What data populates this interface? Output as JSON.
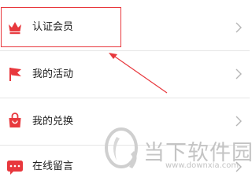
{
  "menu": {
    "items": [
      {
        "label": "认证会员",
        "icon": "crown-icon"
      },
      {
        "label": "我的活动",
        "icon": "flag-icon"
      },
      {
        "label": "我的兑换",
        "icon": "shopping-bag-icon"
      },
      {
        "label": "在线留言",
        "icon": "chat-bubble-icon"
      }
    ]
  },
  "watermark": {
    "name": "当下软件园",
    "url": "www.downxia.com"
  },
  "colors": {
    "accent": "#e8383d",
    "text": "#222222",
    "chevron": "#b5b5b5",
    "divider": "#e6e6e6",
    "watermark": "#c4c4c4"
  }
}
